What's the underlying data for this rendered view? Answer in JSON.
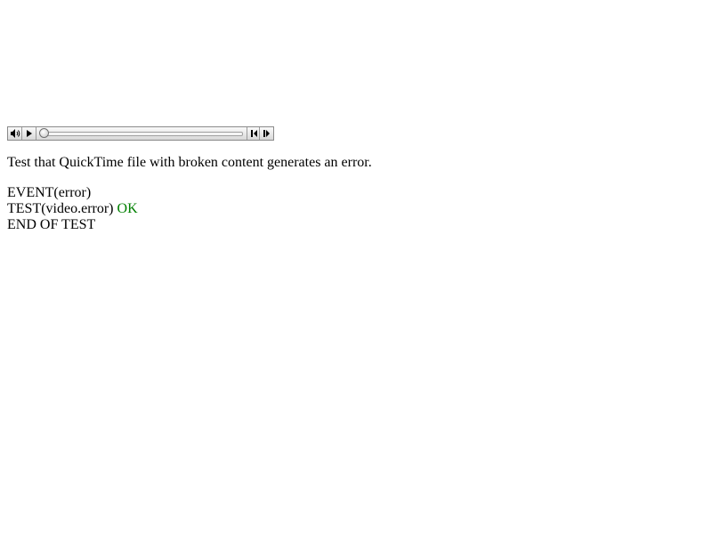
{
  "media_controller": {
    "volume_icon": "speaker-icon",
    "play_icon": "play-icon",
    "back_icon": "step-back-icon",
    "forward_icon": "step-forward-icon",
    "progress": 0
  },
  "description": "Test that QuickTime file with broken content generates an error.",
  "log": {
    "event": "EVENT(error)",
    "test": "TEST(video.error)",
    "test_result": "OK",
    "end": "END OF TEST"
  },
  "colors": {
    "ok": "#008000"
  }
}
